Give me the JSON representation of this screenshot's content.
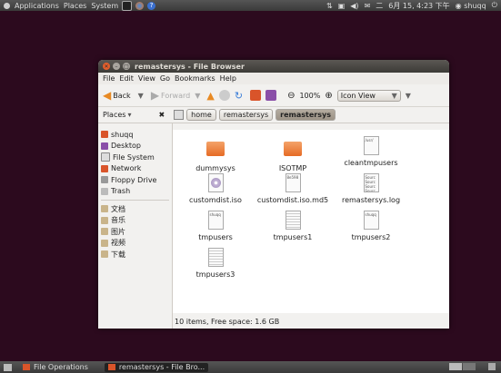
{
  "top_panel": {
    "menus": [
      "Applications",
      "Places",
      "System"
    ],
    "clock": "6月 15, 4:23 下午",
    "user": "shuqq",
    "time_prefix": "二"
  },
  "window": {
    "title": "remastersys - File Browser",
    "menus": [
      "File",
      "Edit",
      "View",
      "Go",
      "Bookmarks",
      "Help"
    ],
    "toolbar": {
      "back_label": "Back",
      "forward_label": "Forward",
      "zoom": "100%",
      "view_mode": "Icon View"
    },
    "breadcrumbs": [
      "home",
      "remastersys",
      "remastersys"
    ],
    "sidebar": {
      "header": "Places",
      "items": [
        "shuqq",
        "Desktop",
        "File System",
        "Network",
        "Floppy Drive",
        "Trash",
        "文档",
        "音乐",
        "图片",
        "视频",
        "下载"
      ]
    },
    "files": [
      {
        "name": "dummysys",
        "type": "folder"
      },
      {
        "name": "ISOTMP",
        "type": "folder"
      },
      {
        "name": "cleantmpusers",
        "type": "doc",
        "preview": "/usr/"
      },
      {
        "name": "customdist.iso",
        "type": "iso"
      },
      {
        "name": "customdist.iso.md5",
        "type": "doc",
        "preview": "8e598"
      },
      {
        "name": "remastersys.log",
        "type": "doc",
        "preview": "Sourc Sourc Sourc Sourc"
      },
      {
        "name": "tmpusers",
        "type": "doc",
        "preview": "shuqq"
      },
      {
        "name": "tmpusers1",
        "type": "doc",
        "preview": ""
      },
      {
        "name": "tmpusers2",
        "type": "doc",
        "preview": "shuqq"
      },
      {
        "name": "tmpusers3",
        "type": "doc",
        "preview": ""
      }
    ],
    "status": "10 items, Free space: 1.6 GB"
  },
  "taskbar": {
    "tasks": [
      "File Operations",
      "remastersys - File Bro..."
    ]
  },
  "colors": {
    "desktop": "#2c0a1e",
    "folder": "#e66b25",
    "panel": "#3a3a3a"
  }
}
